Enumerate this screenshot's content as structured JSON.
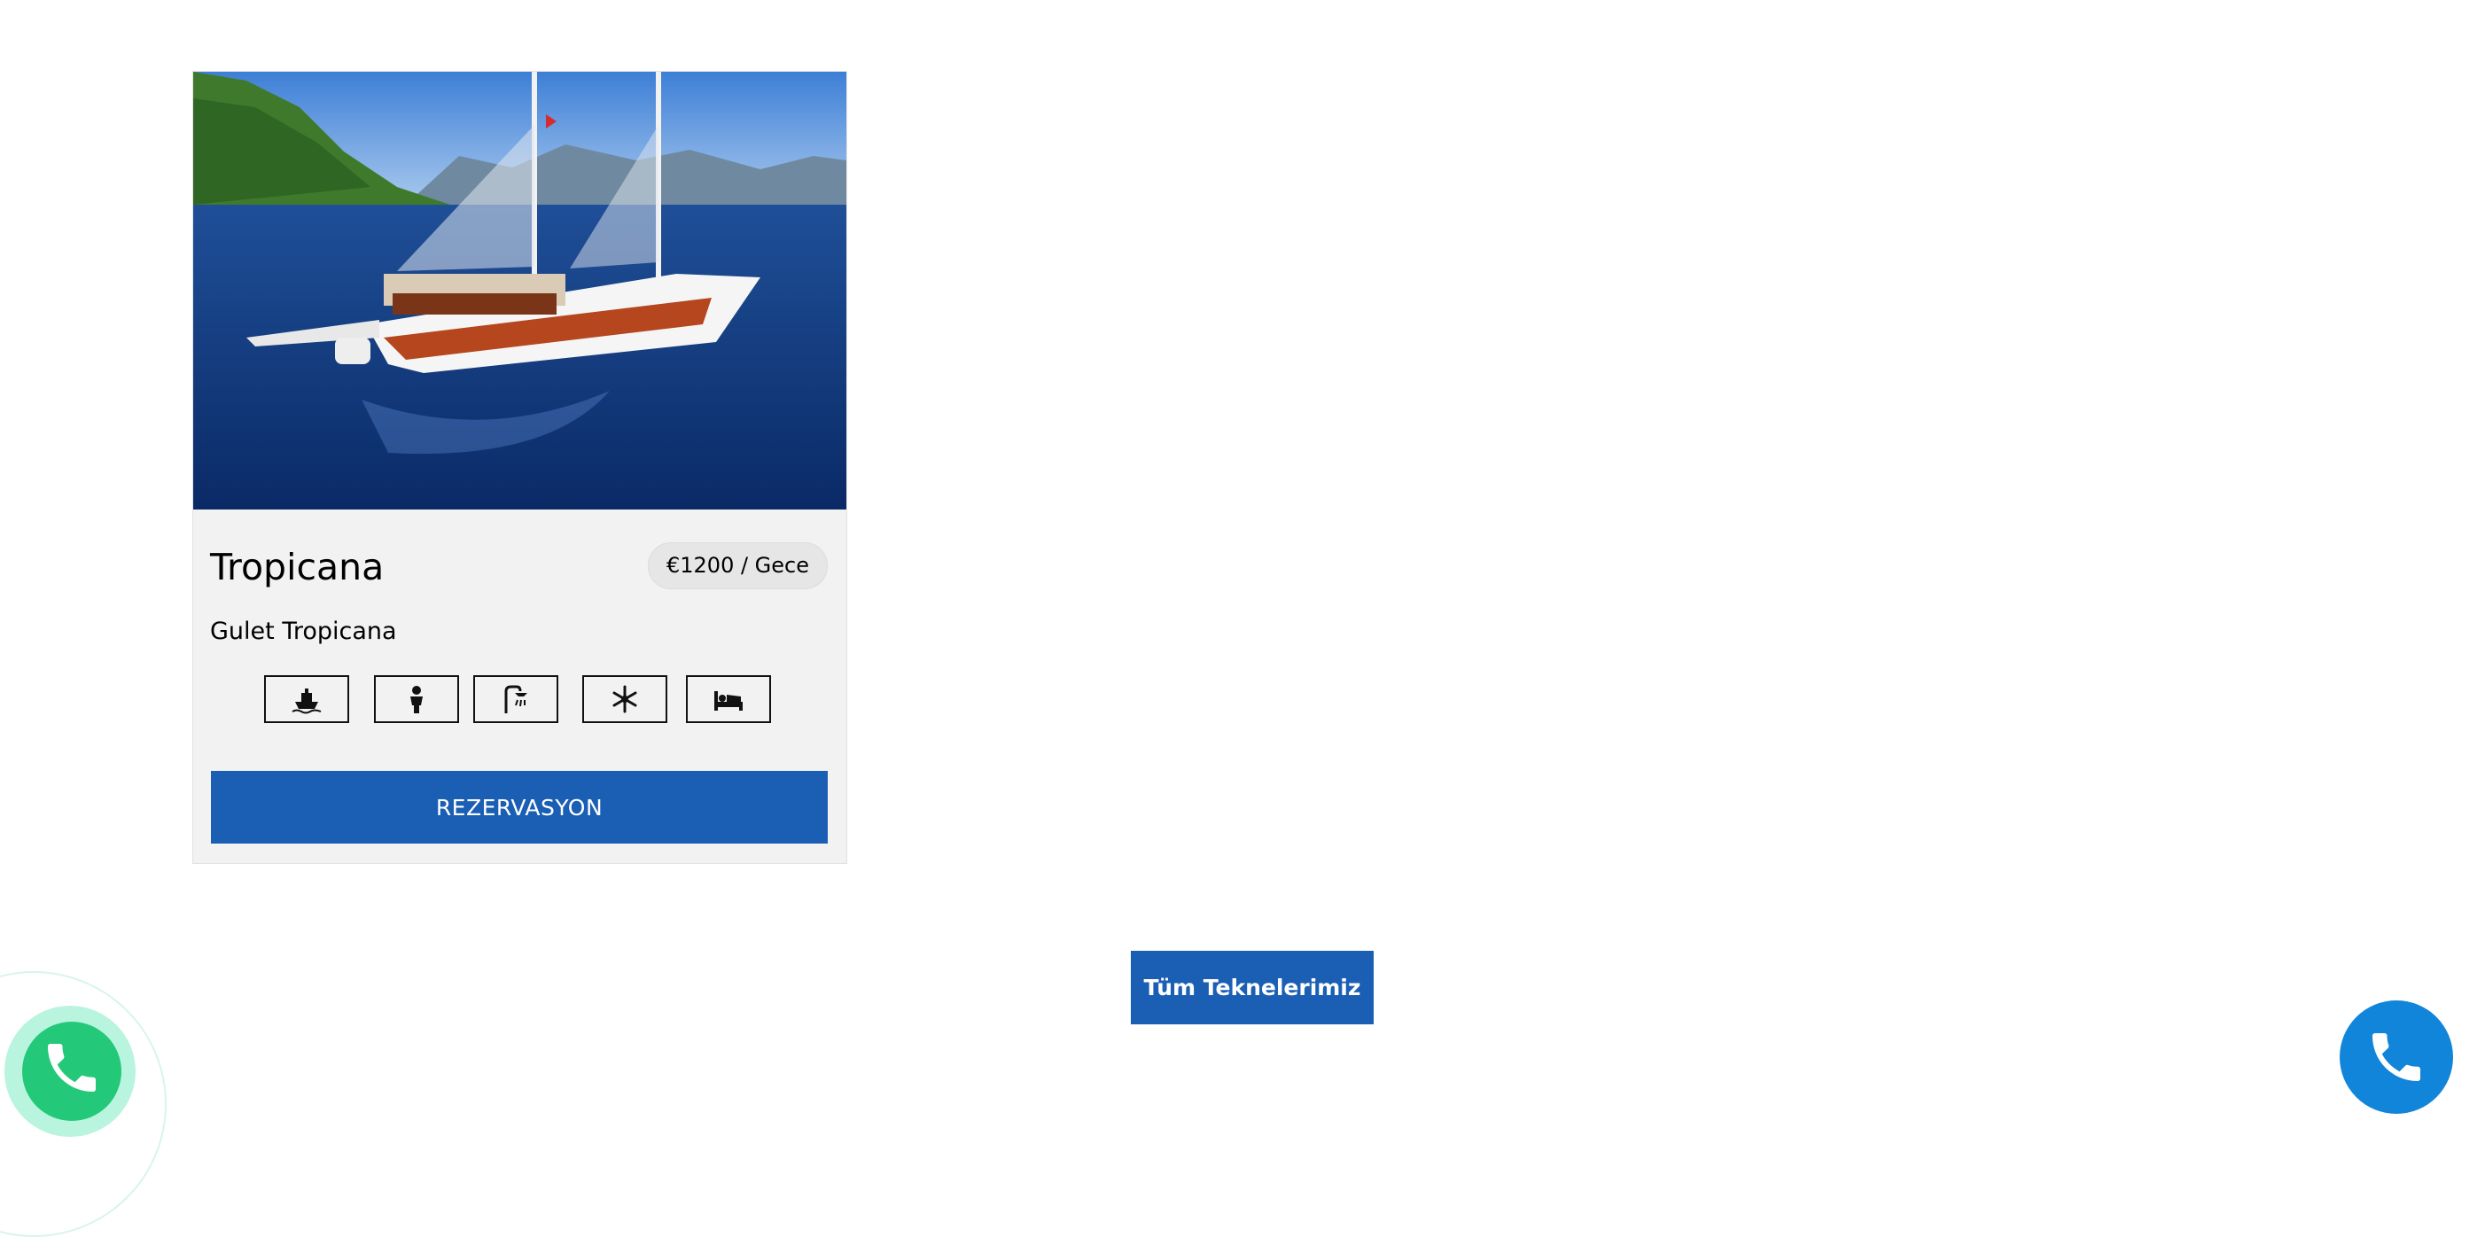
{
  "boat_card": {
    "image_alt": "Tropicana gulet sailing on the sea",
    "title": "Tropicana",
    "price": "€1200 / Gece",
    "subtitle": "Gulet Tropicana",
    "features": [
      {
        "icon": "ship-icon"
      },
      {
        "icon": "captain-icon"
      },
      {
        "icon": "shower-icon"
      },
      {
        "icon": "snowflake-icon"
      },
      {
        "icon": "bed-icon"
      }
    ],
    "reserve_label": "REZERVASYON"
  },
  "all_boats_label": "Tüm Teknelerimiz",
  "floating": {
    "whatsapp_icon": "whatsapp-phone-icon",
    "call_icon": "phone-icon"
  },
  "colors": {
    "primary": "#1a5fb4",
    "whatsapp": "#23c979",
    "call": "#1185d9"
  }
}
